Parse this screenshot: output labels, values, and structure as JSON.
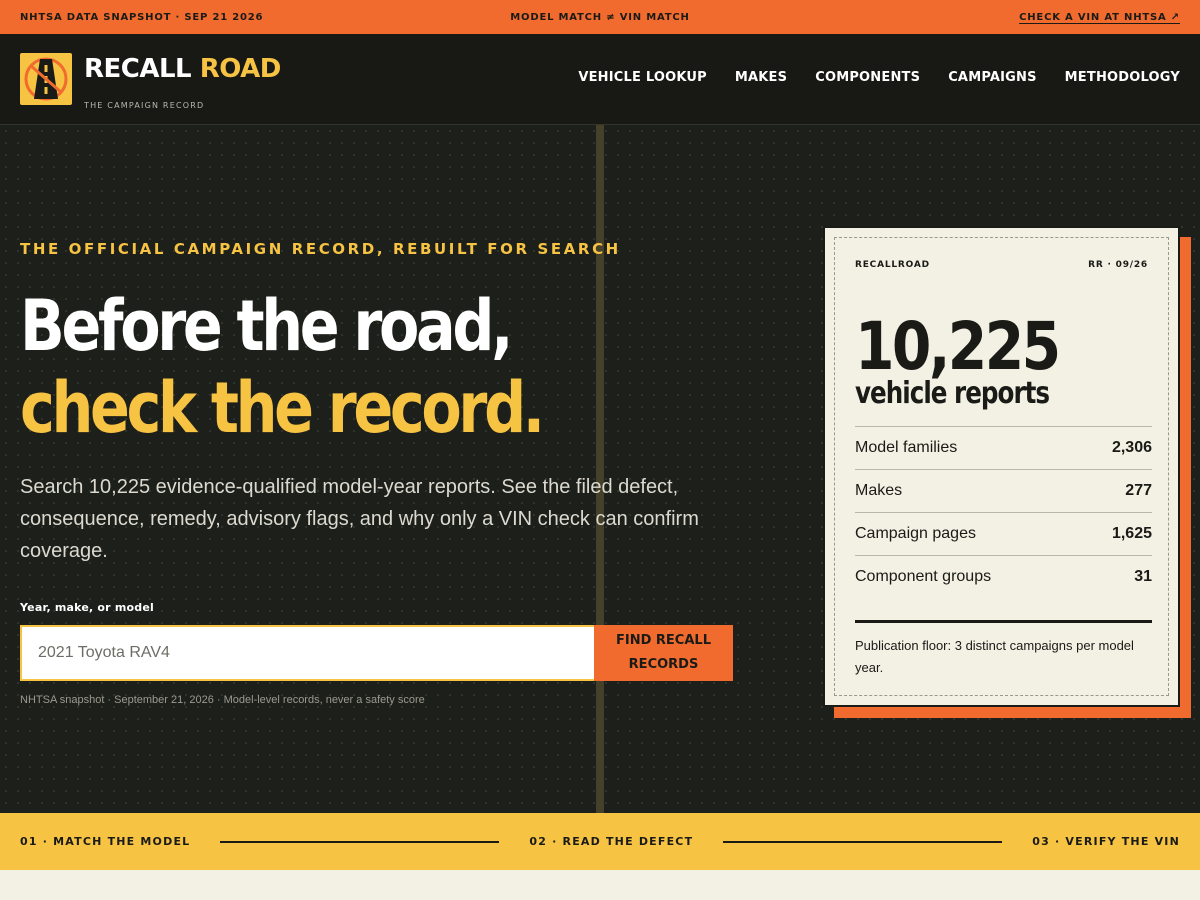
{
  "topbar": {
    "left": "NHTSA DATA SNAPSHOT · SEP 21 2026",
    "center": "MODEL MATCH ≠ VIN MATCH",
    "right": "CHECK A VIN AT NHTSA ↗"
  },
  "header": {
    "brand_part1": "RECALL",
    "brand_part2": "ROAD",
    "tagline": "THE CAMPAIGN RECORD",
    "nav": [
      "VEHICLE LOOKUP",
      "MAKES",
      "COMPONENTS",
      "CAMPAIGNS",
      "METHODOLOGY"
    ]
  },
  "hero": {
    "eyebrow": "THE OFFICIAL CAMPAIGN RECORD, REBUILT FOR SEARCH",
    "headline_line1": "Before the road,",
    "headline_line2": "check the record.",
    "lede": "Search 10,225 evidence-qualified model-year reports. See the filed defect, consequence, remedy, advisory flags, and why only a VIN check can confirm coverage.",
    "search": {
      "label": "Year, make, or model",
      "placeholder": "2021 Toyota RAV4",
      "button": "FIND RECALL RECORDS"
    },
    "footnote": "NHTSA snapshot · September 21, 2026 · Model-level records, never a safety score"
  },
  "card": {
    "brand": "RECALLROAD",
    "code": "RR · 09/26",
    "big_number": "10,225",
    "big_label": "vehicle reports",
    "stats": [
      {
        "label": "Model families",
        "value": "2,306"
      },
      {
        "label": "Makes",
        "value": "277"
      },
      {
        "label": "Campaign pages",
        "value": "1,625"
      },
      {
        "label": "Component groups",
        "value": "31"
      }
    ],
    "note": "Publication floor: 3 distinct campaigns per model year."
  },
  "steps": [
    "01 · MATCH THE MODEL",
    "02 · READ THE DEFECT",
    "03 · VERIFY THE VIN"
  ],
  "colors": {
    "orange": "#f26b2e",
    "yellow": "#f6c343",
    "dark": "#1d1f1a",
    "cream": "#f3f0e4"
  }
}
